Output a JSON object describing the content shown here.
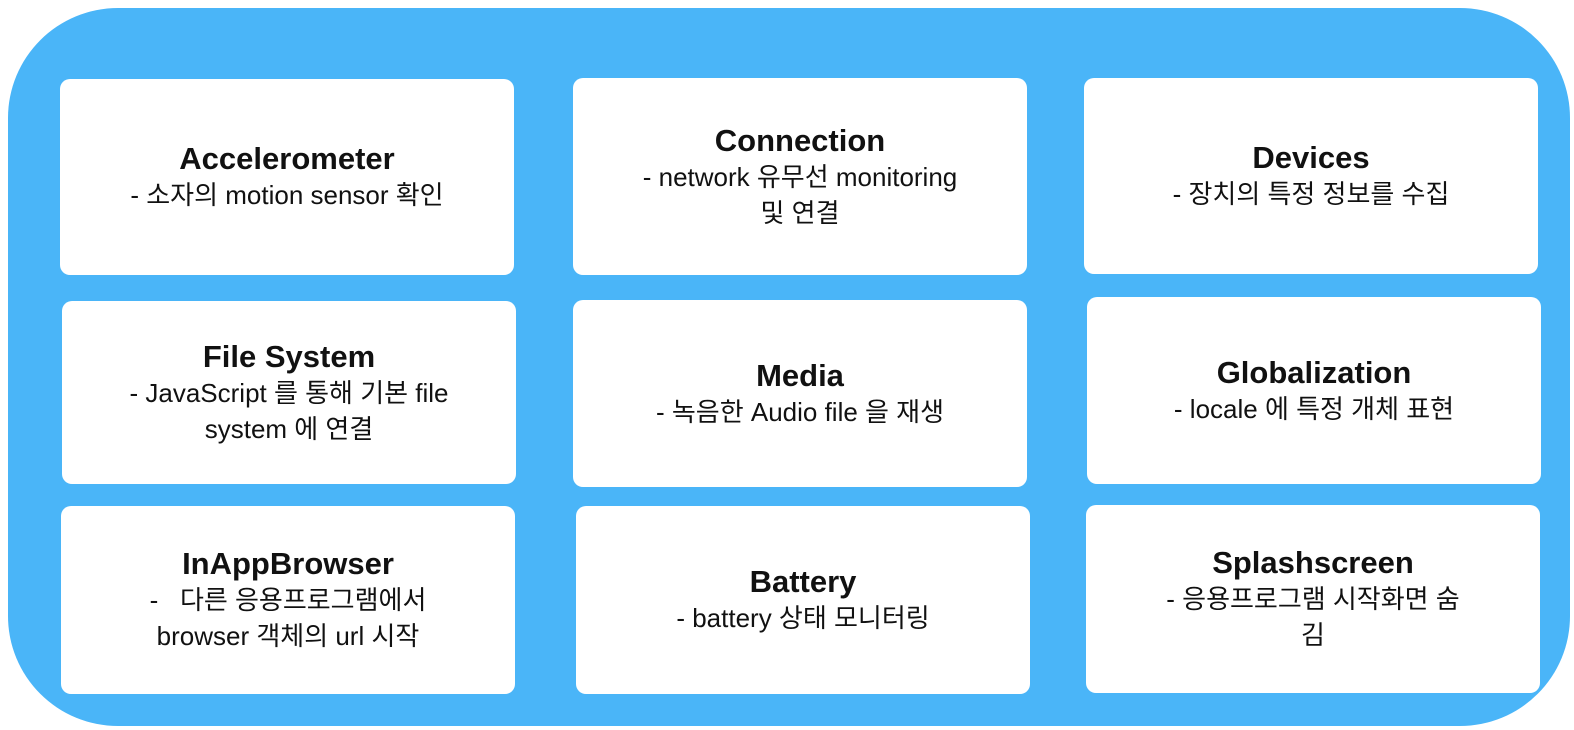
{
  "cards": [
    {
      "title": "Accelerometer",
      "lines": [
        "- 소자의 motion sensor 확인"
      ]
    },
    {
      "title": "Connection",
      "lines": [
        "- network 유무선 monitoring",
        "및 연결"
      ]
    },
    {
      "title": "Devices",
      "lines": [
        "- 장치의 특정 정보를 수집"
      ]
    },
    {
      "title": "File System",
      "lines": [
        "- JavaScript 를 통해 기본 file",
        "system 에 연결"
      ]
    },
    {
      "title": "Media",
      "lines": [
        "- 녹음한 Audio file 을 재생"
      ]
    },
    {
      "title": "Globalization",
      "lines": [
        "- locale 에 특정 개체 표현"
      ]
    },
    {
      "title": "InAppBrowser",
      "lines": [
        "-   다른 응용프로그램에서",
        "browser 객체의 url 시작"
      ]
    },
    {
      "title": "Battery",
      "lines": [
        "- battery 상태 모니터링"
      ]
    },
    {
      "title": "Splashscreen",
      "lines": [
        "- 응용프로그램 시작화면 숨",
        "김"
      ]
    }
  ],
  "colors": {
    "panel_background": "#4ab5f8",
    "card_background": "#ffffff",
    "text": "#111111"
  }
}
